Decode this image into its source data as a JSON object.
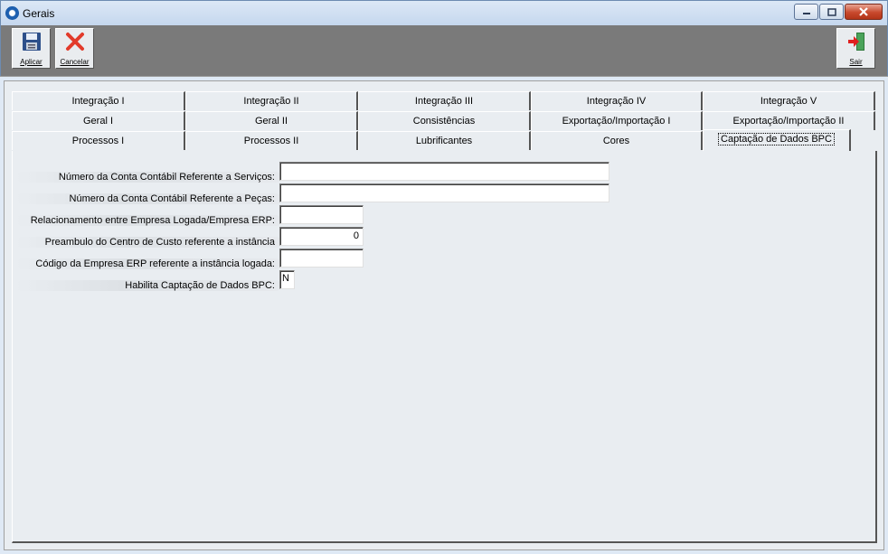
{
  "window": {
    "title": "Gerais"
  },
  "toolbar": {
    "apply_label": "Aplicar",
    "cancel_label": "Cancelar",
    "exit_label": "Sair"
  },
  "tabs": {
    "row1": [
      "Integração I",
      "Integração II",
      "Integração III",
      "Integração IV",
      "Integração V"
    ],
    "row2": [
      "Geral I",
      "Geral II",
      "Consistências",
      "Exportação/Importação I",
      "Exportação/Importação II"
    ],
    "row3": [
      "Processos I",
      "Processos II",
      "Lubrificantes",
      "Cores",
      "Captação de Dados BPC"
    ],
    "active": "Captação de Dados BPC"
  },
  "form": {
    "fields": [
      {
        "label": "Número da Conta Contábil Referente a Serviços:",
        "value": ""
      },
      {
        "label": "Número da Conta Contábil Referente a Peças:",
        "value": ""
      },
      {
        "label": "Relacionamento entre Empresa Logada/Empresa ERP:",
        "value": ""
      },
      {
        "label": "Preambulo do Centro de Custo referente a instância",
        "value": "0"
      },
      {
        "label": "Código da Empresa ERP referente a instância logada:",
        "value": ""
      },
      {
        "label": "Habilita Captação de Dados BPC:",
        "value": "N"
      }
    ]
  }
}
